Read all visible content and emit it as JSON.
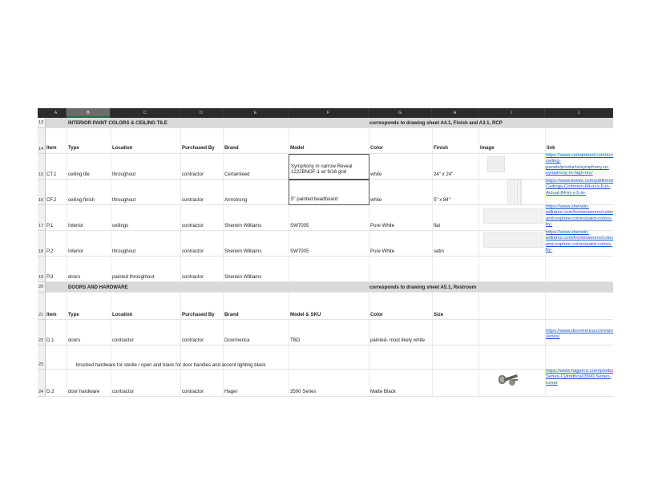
{
  "columns": [
    "A",
    "B",
    "C",
    "D",
    "E",
    "F",
    "G",
    "H",
    "I",
    "J"
  ],
  "rows": {
    "r13": {
      "num": "13",
      "title": "INTERIOR PAINT COLORS & CEILING TILE",
      "note": "corresponds to drawing sheet A4.1, Finish and A3.1, RCP"
    },
    "r14": {
      "num": "14",
      "item": "Item",
      "type": "Type",
      "location": "Location",
      "purchased": "Purchased By",
      "brand": "Brand",
      "model": "Model",
      "color": "Color",
      "finish": "Finish",
      "image": "Image",
      "link": "link"
    },
    "r15": {
      "num": "15",
      "item": "CT.1",
      "type": "ceiling tile",
      "location": "throughout",
      "purchased": "contractor",
      "brand": "Certainteed",
      "model": "Symphony m narrow Reveal 1222BNOF-1 w/ 9/16 grid",
      "color": "white",
      "finish": "24\" x 24\"",
      "link": "https://www.certainteed.com/acoustical-ceiling-panels/products/symphony-m-symphony-m-high-nrc/"
    },
    "r16": {
      "num": "16",
      "item": "CF.2",
      "type": "ceiling finish",
      "location": "throughout",
      "purchased": "contractor",
      "brand": "Armstrong",
      "model": "5\" painted beadboard",
      "color": "white",
      "finish": "5\" x 84\"",
      "link": "https://www.lowes.com/pd/Armstrong-Ceilings-Common-84-in-x-5-in-Actual-84-in-x-5-in-"
    },
    "r17": {
      "num": "17",
      "item": "P.1",
      "type": "Interior",
      "location": "ceilings",
      "purchased": "contractor",
      "brand": "Sherwin Williams",
      "model": "SW7005",
      "color": "Pure White",
      "finish": "flat",
      "link": "https://www.sherwin-williams.com/homeowners/color/find-and-explore-colors/paint-colors-by-"
    },
    "r18": {
      "num": "18",
      "item": "P.2",
      "type": "Interior",
      "location": "throughout",
      "purchased": "contractor",
      "brand": "Sherwin Williams",
      "model": "SW7005",
      "color": "Pure White",
      "finish": "satin",
      "link": "https://www.sherwin-williams.com/homeowners/color/find-and-explore-colors/paint-colors-by-"
    },
    "r19": {
      "num": "19",
      "item": "P.3",
      "type": "doors",
      "location": "painted throughtout",
      "purchased": "contractor",
      "brand": "Sherwin Williams"
    },
    "r20": {
      "num": "20",
      "title": "DOORS AND HARDWARE",
      "note": "corresponds to drawing sheet A5.1, Restroom"
    },
    "r21": {
      "num": "21",
      "item": "Item",
      "type": "Type",
      "location": "Location",
      "purchased": "Purchased By",
      "brand": "Brand",
      "model": "Model & SKU",
      "color": "Color",
      "size": "Size"
    },
    "r22": {
      "num": "22",
      "item": "D.1",
      "type": "doors",
      "location": "contractor",
      "purchased": "contractor",
      "brand": "Doormerica",
      "model": "TBD",
      "color": "painted- most likely white",
      "link": "https://www.doormerica.com/american-series/"
    },
    "r23": {
      "num": "23",
      "note": "brushed hardware for sterile / open and black for door handles and accent lighting black"
    },
    "r24": {
      "num": "24",
      "item": "D.2",
      "type": "door hardware",
      "location": "contractor",
      "purchased": "contractor",
      "brand": "Hager",
      "model": "3500 Series",
      "color": "Matte Black",
      "link": "https://www.hagerco.com/products/Locks/3500-Series-Cylindrical/3500-Series-Lever"
    }
  },
  "colors": {
    "header_bg": "#2b2b2b",
    "section_bg": "#d9d9d9",
    "link": "#1a56c8",
    "selected_header": "#6b6b6b"
  }
}
